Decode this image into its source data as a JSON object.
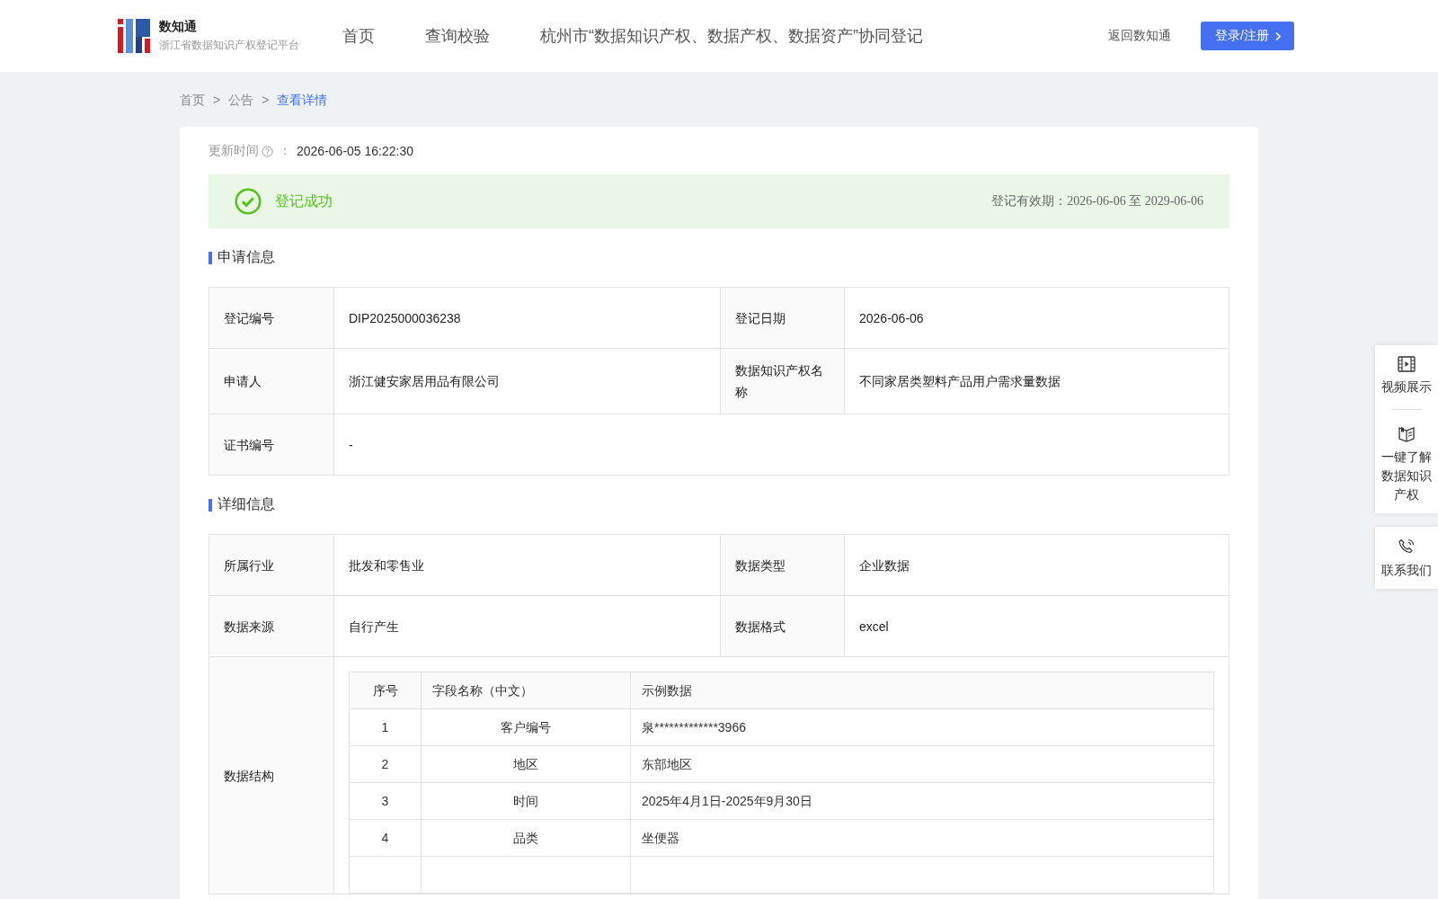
{
  "header": {
    "logo": {
      "name": "数知通",
      "subtitle": "浙江省数据知识产权登记平台"
    },
    "nav": [
      "首页",
      "查询校验",
      "杭州市“数据知识产权、数据产权、数据资产”协同登记"
    ],
    "back_link": "返回数知通",
    "login_button": "登录/注册"
  },
  "breadcrumb": [
    {
      "label": "首页",
      "current": false
    },
    {
      "label": "公告",
      "current": false
    },
    {
      "label": "查看详情",
      "current": true
    }
  ],
  "breadcrumb_separator": ">",
  "update_time": {
    "label": "更新时间",
    "separator": "：",
    "value": "2026-06-05 16:22:30"
  },
  "status": {
    "text": "登记成功",
    "validity": "登记有效期：2026-06-06 至 2029-06-06"
  },
  "sections": [
    {
      "title": "申请信息",
      "rows": [
        [
          {
            "label": "登记编号",
            "value": "DIP2025000036238"
          },
          {
            "label": "登记日期",
            "value": "2026-06-06"
          }
        ],
        [
          {
            "label": "申请人",
            "value": "浙江健安家居用品有限公司"
          },
          {
            "label": "数据知识产权名称",
            "value": "不同家居类塑料产品用户需求量数据"
          }
        ],
        [
          {
            "label": "证书编号",
            "value": "-"
          }
        ]
      ]
    },
    {
      "title": "详细信息",
      "rows": [
        [
          {
            "label": "所属行业",
            "value": "批发和零售业"
          },
          {
            "label": "数据类型",
            "value": "企业数据"
          }
        ],
        [
          {
            "label": "数据来源",
            "value": "自行产生"
          },
          {
            "label": "数据格式",
            "value": "excel"
          }
        ],
        [
          {
            "label": "数据结构",
            "table": {
              "columns": [
                "序号",
                "字段名称（中文）",
                "示例数据"
              ],
              "rows": [
                [
                  "1",
                  "客户编号",
                  "泉*************3966"
                ],
                [
                  "2",
                  "地区",
                  "东部地区"
                ],
                [
                  "3",
                  "时间",
                  "2025年4月1日-2025年9月30日"
                ],
                [
                  "4",
                  "品类",
                  "坐便器"
                ]
              ]
            }
          }
        ]
      ]
    }
  ],
  "side_panel": [
    {
      "items": [
        "视频展示",
        "一键了解数据知识产权"
      ]
    },
    {
      "items": [
        "联系我们"
      ]
    }
  ]
}
